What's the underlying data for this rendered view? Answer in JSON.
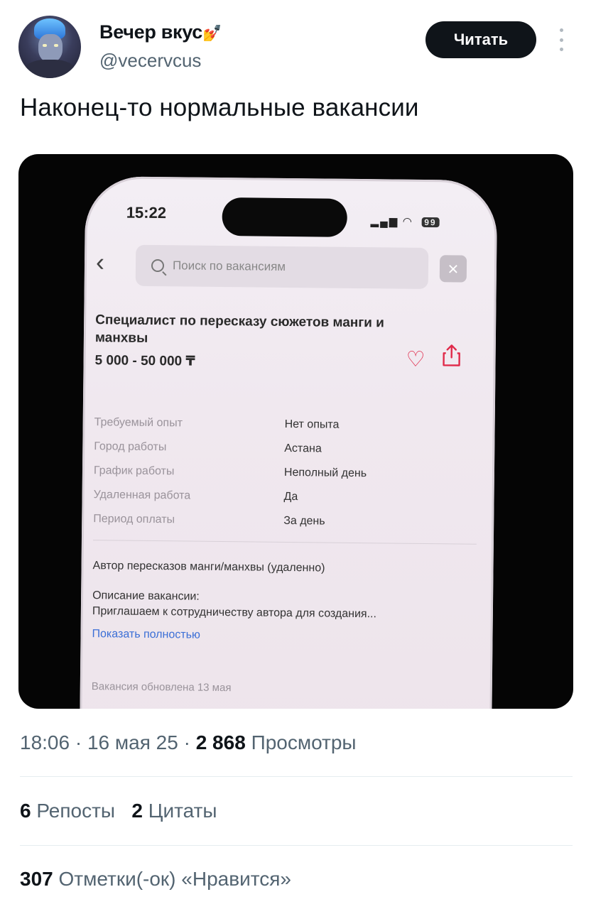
{
  "author": {
    "name": "Вечер вкус",
    "name_emoji": "💅",
    "handle": "@vecervcus"
  },
  "follow_button": "Читать",
  "more_icon": "more-vertical-icon",
  "tweet_text": "Наконец-то нормальные вакансии",
  "media": {
    "phone_time": "15:22",
    "battery": "99",
    "search_placeholder": "Поиск по вакансиям",
    "job_title": "Специалист по пересказу сюжетов манги и манхвы",
    "salary": "5 000 - 50 000 ₸",
    "specs": [
      {
        "label": "Требуемый опыт",
        "value": "Нет опыта"
      },
      {
        "label": "Город работы",
        "value": "Астана"
      },
      {
        "label": "График работы",
        "value": "Неполный день"
      },
      {
        "label": "Удаленная работа",
        "value": "Да"
      },
      {
        "label": "Период оплаты",
        "value": "За день"
      }
    ],
    "author_line": "Автор пересказов манги/манхвы (удаленно)",
    "description_label": "Описание вакансии:",
    "description_text": "Приглашаем к сотрудничеству автора для создания...",
    "show_more": "Показать полностью",
    "updated": "Вакансия обновлена 13 мая",
    "accent_color": "#e02a4a"
  },
  "meta": {
    "time": "18:06",
    "date": "16 мая 25",
    "views_count": "2 868",
    "views_label": "Просмотры"
  },
  "stats": {
    "reposts_count": "6",
    "reposts_label": "Репосты",
    "quotes_count": "2",
    "quotes_label": "Цитаты",
    "likes_count": "307",
    "likes_label": "Отметки(-ок) «Нравится»"
  }
}
